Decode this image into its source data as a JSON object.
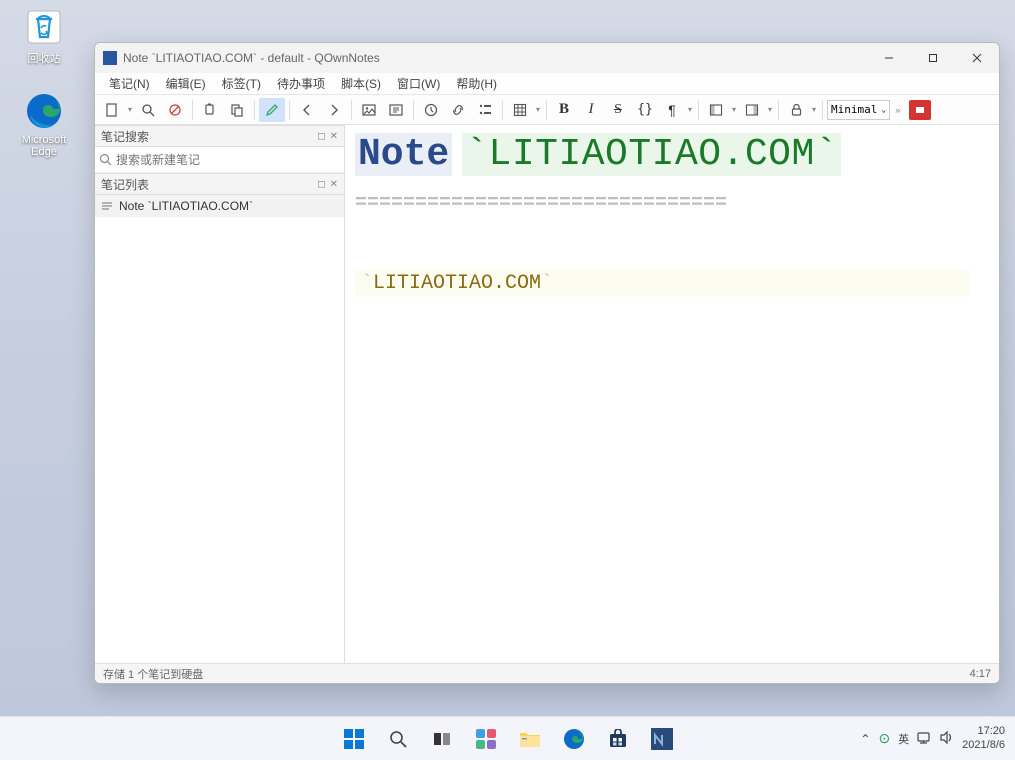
{
  "desktop": {
    "recycle_label": "回收站",
    "edge_label": "Microsoft\nEdge"
  },
  "window": {
    "title": "Note `LITIAOTIAO.COM` - default - QOwnNotes"
  },
  "menu": {
    "items": [
      "笔记(N)",
      "编辑(E)",
      "标签(T)",
      "待办事项",
      "脚本(S)",
      "窗口(W)",
      "帮助(H)"
    ]
  },
  "toolbar": {
    "style_select": "Minimal"
  },
  "side": {
    "search_panel_title": "笔记搜索",
    "search_placeholder": "搜索或新建笔记",
    "list_panel_title": "笔记列表",
    "note_item": "Note `LITIAOTIAO.COM`"
  },
  "editor": {
    "h1_prefix": "Note",
    "h1_code": "LITIAOTIAO.COM",
    "dashes": "===============================",
    "body_code": "LITIAOTIAO.COM"
  },
  "status": {
    "left": "存储 1 个笔记到硬盘",
    "right": "4:17"
  },
  "tray": {
    "ime": "英",
    "time": "17:20",
    "date": "2021/8/6"
  }
}
